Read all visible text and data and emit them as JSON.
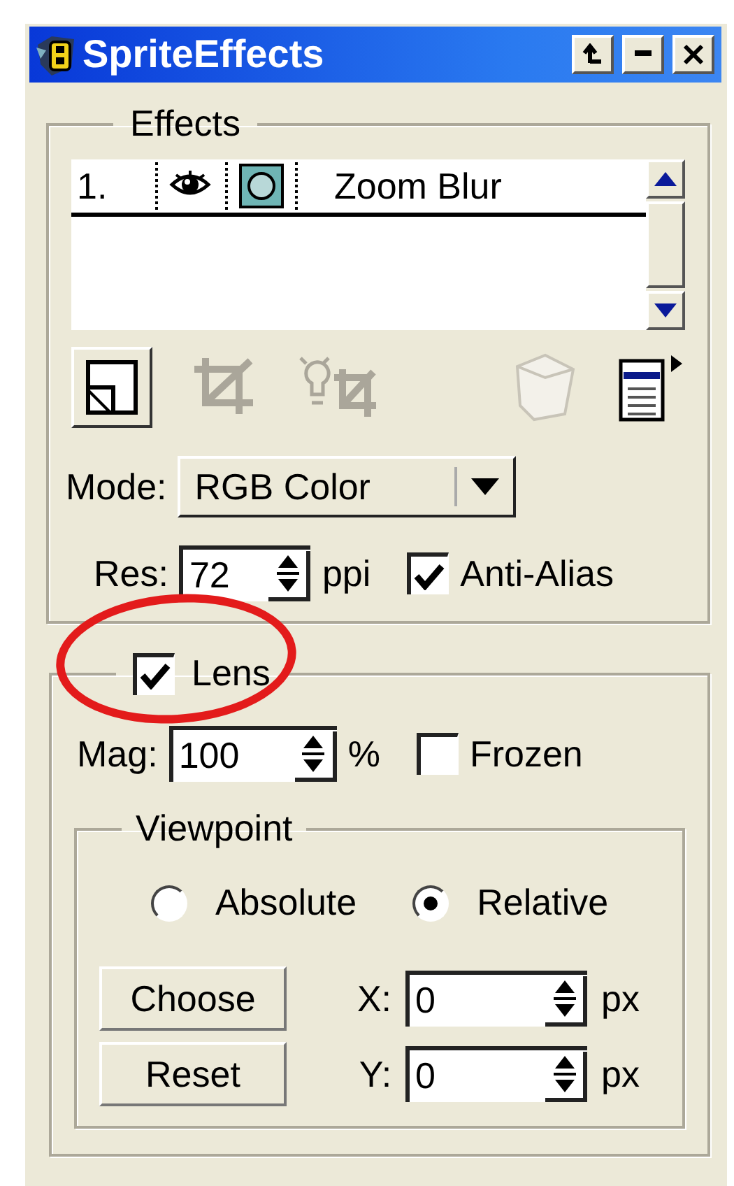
{
  "window": {
    "title": "SpriteEffects"
  },
  "effects": {
    "label": "Effects",
    "items": [
      {
        "number": "1.",
        "visible": true,
        "name": "Zoom Blur"
      }
    ]
  },
  "mode": {
    "label": "Mode:",
    "value": "RGB Color"
  },
  "res": {
    "label": "Res:",
    "value": "72",
    "unit": "ppi"
  },
  "anti_alias": {
    "label": "Anti-Alias",
    "checked": true
  },
  "lens": {
    "label": "Lens",
    "checked": true
  },
  "mag": {
    "label": "Mag:",
    "value": "100",
    "unit": "%"
  },
  "frozen": {
    "label": "Frozen",
    "checked": false
  },
  "viewpoint": {
    "label": "Viewpoint",
    "options": [
      {
        "label": "Absolute",
        "selected": false
      },
      {
        "label": "Relative",
        "selected": true
      }
    ]
  },
  "buttons": [
    "Choose",
    "Reset"
  ],
  "coords": [
    {
      "label": "X:",
      "value": "0",
      "unit": "px"
    },
    {
      "label": "Y:",
      "value": "0",
      "unit": "px"
    }
  ]
}
